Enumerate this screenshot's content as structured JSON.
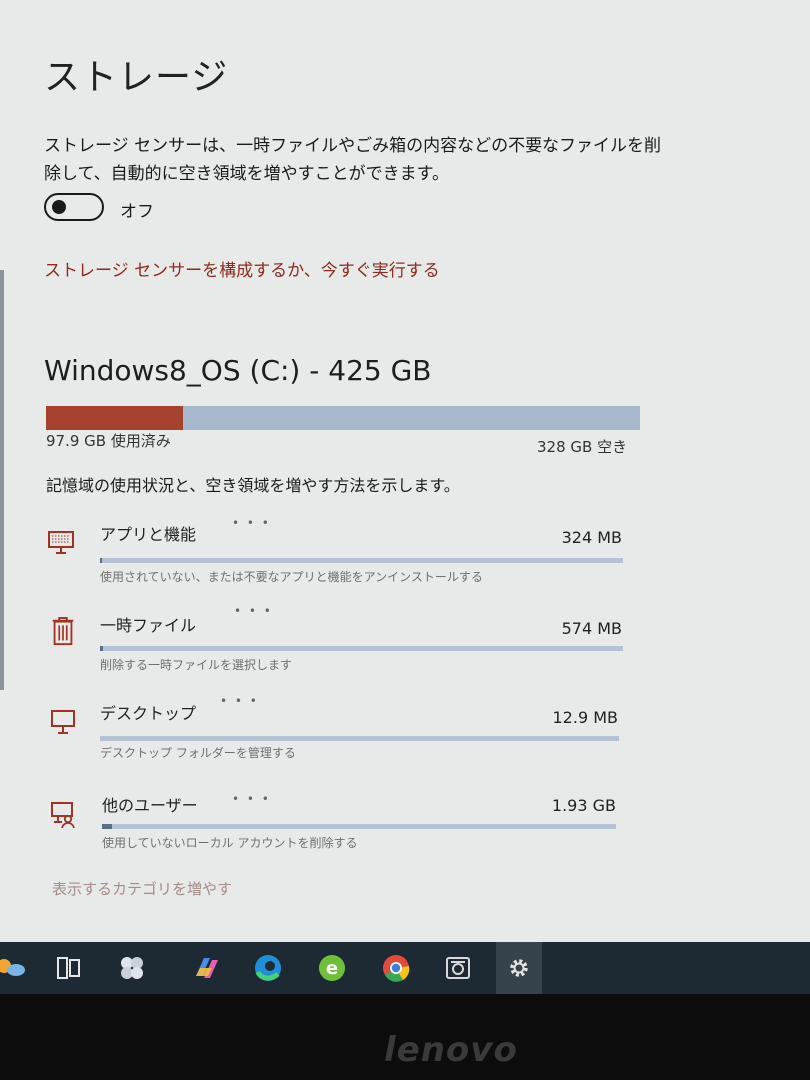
{
  "page": {
    "title": "ストレージ",
    "sense_description": "ストレージ センサーは、一時ファイルやごみ箱の内容などの不要なファイルを削除して、自動的に空き領域を増やすことができます。",
    "toggle_state": "オフ",
    "configure_link": "ストレージ センサーを構成するか、今すぐ実行する"
  },
  "drive": {
    "title": "Windows8_OS (C:) - 425 GB",
    "used_label": "97.9 GB 使用済み",
    "free_label": "328 GB 空き",
    "used_fraction": 0.23,
    "description": "記憶域の使用状況と、空き領域を増やす方法を示します。"
  },
  "categories": [
    {
      "icon": "apps-icon",
      "name": "アプリと機能",
      "size": "324 MB",
      "description": "使用されていない、または不要なアプリと機能をアンインストールする",
      "fraction": 0.003
    },
    {
      "icon": "trash-icon",
      "name": "一時ファイル",
      "size": "574 MB",
      "description": "削除する一時ファイルを選択します",
      "fraction": 0.005
    },
    {
      "icon": "desktop-icon",
      "name": "デスクトップ",
      "size": "12.9 MB",
      "description": "デスクトップ フォルダーを管理する",
      "fraction": 0.0
    },
    {
      "icon": "other-users-icon",
      "name": "他のユーザー",
      "size": "1.93 GB",
      "description": "使用していないローカル アカウントを削除する",
      "fraction": 0.02
    }
  ],
  "more_categories_link": "表示するカテゴリを増やす",
  "taskbar": {
    "items": [
      "weather-icon",
      "task-view-icon",
      "app-icon",
      "copilot-icon",
      "edge-icon",
      "ie-icon",
      "chrome-icon",
      "camera-icon",
      "settings-icon"
    ]
  },
  "bezel": {
    "brand": "lenovo"
  },
  "colors": {
    "accent": "#a5422f",
    "link": "#8f2a20",
    "bar_free": "#a7b8cc",
    "taskbar": "#1d2a33"
  }
}
